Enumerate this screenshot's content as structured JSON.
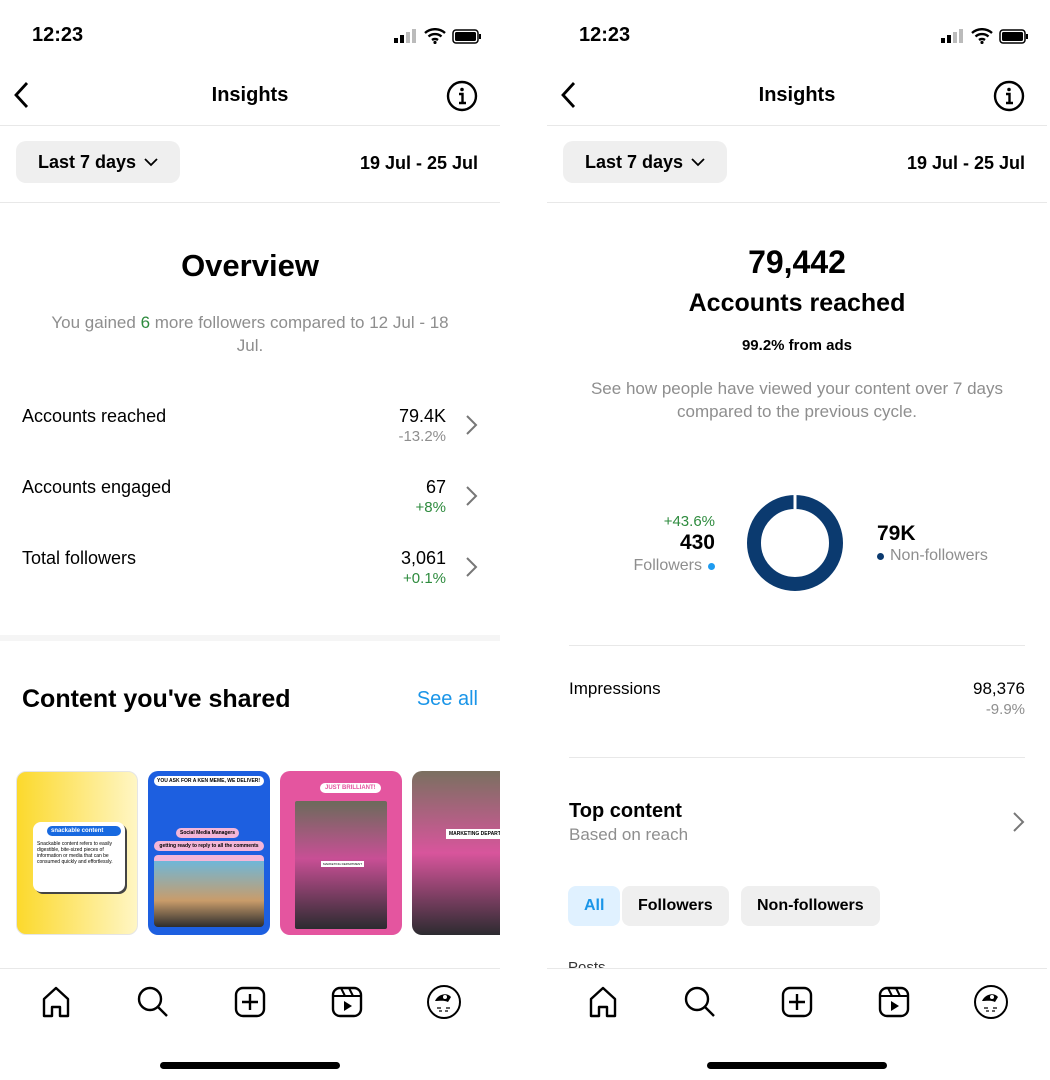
{
  "status": {
    "time": "12:23"
  },
  "header": {
    "title": "Insights"
  },
  "range": {
    "label": "Last 7 days",
    "dates": "19 Jul - 25 Jul"
  },
  "overview": {
    "title": "Overview",
    "sub_pre": "You gained ",
    "sub_num": "6",
    "sub_post": " more followers compared to 12 Jul - 18 Jul.",
    "rows": [
      {
        "label": "Accounts reached",
        "value": "79.4K",
        "change": "-13.2%",
        "trend": "down"
      },
      {
        "label": "Accounts engaged",
        "value": "67",
        "change": "+8%",
        "trend": "up"
      },
      {
        "label": "Total followers",
        "value": "3,061",
        "change": "+0.1%",
        "trend": "up"
      }
    ],
    "content_title": "Content you've shared",
    "see_all": "See all",
    "thumbs": [
      {
        "chip": "snackable content",
        "text": "Snackable content refers to easily digestible, bite-sized pieces of information or media that can be consumed quickly and effortlessly."
      },
      {
        "banner": "YOU ASK FOR A KEN MEME, WE DELIVER!",
        "l1": "Social Media Managers",
        "l2": "getting ready to reply to all the comments"
      },
      {
        "banner": "JUST BRILLIANT!",
        "label": "MARKETING DEPARTMENT"
      },
      {
        "label": "MARKETING DEPARTM"
      }
    ]
  },
  "reach": {
    "total": "79,442",
    "title": "Accounts reached",
    "ads": "99.2% from ads",
    "desc": "See how people have viewed your content over 7 days compared to the previous cycle.",
    "followers": {
      "change": "+43.6%",
      "value": "430",
      "label": "Followers",
      "color": "#1e9bf0"
    },
    "nonfollowers": {
      "value": "79K",
      "label": "Non-followers",
      "color": "#0b3a6f"
    },
    "follower_share": 0.5,
    "impressions": {
      "label": "Impressions",
      "value": "98,376",
      "change": "-9.9%"
    },
    "top": {
      "title": "Top content",
      "sub": "Based on reach"
    },
    "chips": [
      {
        "label": "All",
        "active": true
      },
      {
        "label": "Followers"
      },
      {
        "label": "Non-followers"
      }
    ],
    "posts": "Posts"
  },
  "nav": [
    "home-icon",
    "search-icon",
    "create-icon",
    "reels-icon",
    "profile-avatar"
  ]
}
